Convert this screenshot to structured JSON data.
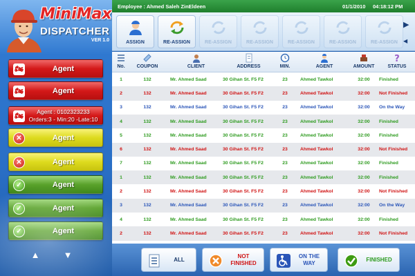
{
  "app": {
    "logo_word": "MiniMax",
    "title": "DISPATCHER",
    "version": "VER 1.0"
  },
  "header": {
    "employee": "Employee : Ahmed Saleh ZinEldeen",
    "date": "01/1/2010",
    "time": "04:18:12 PM"
  },
  "toolbar": {
    "assign_label": "ASSIGN",
    "reassign_label": "RE-ASSIGN",
    "disabled_labels": [
      "RE-ASSIGN",
      "RE-ASSIGN",
      "RE-ASSIGN",
      "RE-ASSIGN",
      "RE-ASSIGN"
    ]
  },
  "agents": [
    {
      "label": "Agent",
      "color": "red",
      "icon": "motorbike-icon"
    },
    {
      "label": "Agent",
      "color": "red",
      "icon": "motorbike-icon"
    },
    {
      "label": "Agent : 0102323233",
      "label2": "Orders:3 - Min:20 -Late:10",
      "color": "red",
      "icon": "motorbike-icon"
    },
    {
      "label": "Agent",
      "color": "yellow",
      "icon": "x-circle-icon"
    },
    {
      "label": "Agent",
      "color": "yellow",
      "icon": "x-circle-icon"
    },
    {
      "label": "Agent",
      "color": "green",
      "icon": "check-circle-icon"
    },
    {
      "label": "Agent",
      "color": "green",
      "icon": "check-circle-icon"
    },
    {
      "label": "Agent",
      "color": "green",
      "icon": "check-circle-icon"
    }
  ],
  "table": {
    "columns": [
      "No.",
      "COUPON",
      "CLIENT",
      "ADDRESS",
      "MIN.",
      "AGENT",
      "AMOUNT",
      "STATUS"
    ],
    "rows": [
      {
        "no": "1",
        "coupon": "132",
        "client": "Mr. Ahmed Saad",
        "address": "30 Gihan St. F5 F2",
        "min": "23",
        "agent": "Ahmed Tawkol",
        "amount": "32:00",
        "status": "Finished",
        "color": "#2e9b1f"
      },
      {
        "no": "2",
        "coupon": "132",
        "client": "Mr. Ahmed Saad",
        "address": "30 Gihan St. F5 F2",
        "min": "23",
        "agent": "Ahmed Tawkol",
        "amount": "32:00",
        "status": "Not Finished",
        "color": "#d01313"
      },
      {
        "no": "3",
        "coupon": "132",
        "client": "Mr. Ahmed Saad",
        "address": "30 Gihan St. F5 F2",
        "min": "23",
        "agent": "Ahmed Tawkol",
        "amount": "32:00",
        "status": "On the Way",
        "color": "#2a55b8"
      },
      {
        "no": "4",
        "coupon": "132",
        "client": "Mr. Ahmed Saad",
        "address": "30 Gihan St. F5 F2",
        "min": "23",
        "agent": "Ahmed Tawkol",
        "amount": "32:00",
        "status": "Finished",
        "color": "#2e9b1f"
      },
      {
        "no": "5",
        "coupon": "132",
        "client": "Mr. Ahmed Saad",
        "address": "30 Gihan St. F5 F2",
        "min": "23",
        "agent": "Ahmed Tawkol",
        "amount": "32:00",
        "status": "Finished",
        "color": "#2e9b1f"
      },
      {
        "no": "6",
        "coupon": "132",
        "client": "Mr. Ahmed Saad",
        "address": "30 Gihan St. F5 F2",
        "min": "23",
        "agent": "Ahmed Tawkol",
        "amount": "32:00",
        "status": "Not Finished",
        "color": "#d01313"
      },
      {
        "no": "7",
        "coupon": "132",
        "client": "Mr. Ahmed Saad",
        "address": "30 Gihan St. F5 F2",
        "min": "23",
        "agent": "Ahmed Tawkol",
        "amount": "32:00",
        "status": "Finished",
        "color": "#2e9b1f"
      },
      {
        "no": "1",
        "coupon": "132",
        "client": "Mr. Ahmed Saad",
        "address": "30 Gihan St. F5 F2",
        "min": "23",
        "agent": "Ahmed Tawkol",
        "amount": "32:00",
        "status": "Finished",
        "color": "#2e9b1f"
      },
      {
        "no": "2",
        "coupon": "132",
        "client": "Mr. Ahmed Saad",
        "address": "30 Gihan St. F5 F2",
        "min": "23",
        "agent": "Ahmed Tawkol",
        "amount": "32:00",
        "status": "Not Finished",
        "color": "#d01313"
      },
      {
        "no": "3",
        "coupon": "132",
        "client": "Mr. Ahmed Saad",
        "address": "30 Gihan St. F5 F2",
        "min": "23",
        "agent": "Ahmed Tawkol",
        "amount": "32:00",
        "status": "On the Way",
        "color": "#2a55b8"
      },
      {
        "no": "4",
        "coupon": "132",
        "client": "Mr. Ahmed Saad",
        "address": "30 Gihan St. F5 F2",
        "min": "23",
        "agent": "Ahmed Tawkol",
        "amount": "32:00",
        "status": "Finished",
        "color": "#2e9b1f"
      },
      {
        "no": "2",
        "coupon": "132",
        "client": "Mr. Ahmed Saad",
        "address": "30 Gihan St. F5 F2",
        "min": "23",
        "agent": "Ahmed Tawkol",
        "amount": "32:00",
        "status": "Not Finished",
        "color": "#d01313"
      }
    ]
  },
  "filters": [
    {
      "label": "ALL",
      "color": "#1a3a6a",
      "icon": "all-orders-icon"
    },
    {
      "label": "NOT FINISHED",
      "color": "#d01313",
      "icon": "x-circle-icon"
    },
    {
      "label": "ON THE WAY",
      "color": "#2a55b8",
      "icon": "wheelchair-icon"
    },
    {
      "label": "FINISHED",
      "color": "#2e9b1f",
      "icon": "check-circle-icon"
    }
  ],
  "colors": {
    "header_green": "#2a8f38",
    "finished": "#2e9b1f",
    "not_finished": "#d01313",
    "on_the_way": "#2a55b8"
  }
}
